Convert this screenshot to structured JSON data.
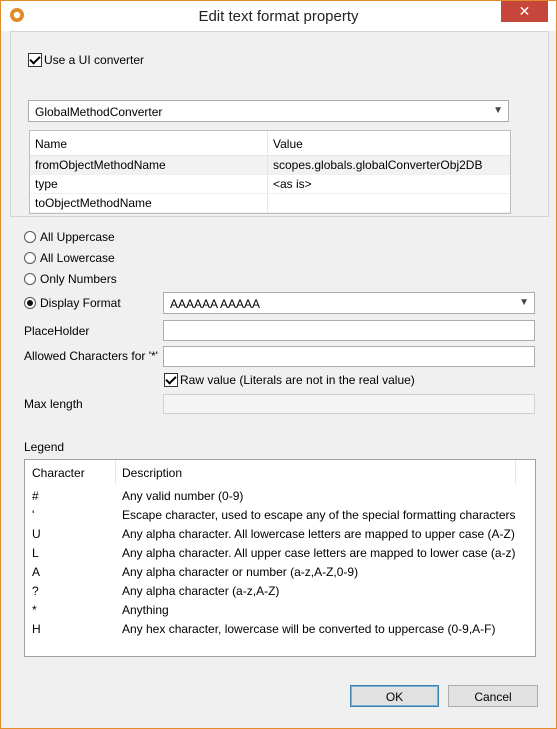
{
  "window": {
    "title": "Edit text format property"
  },
  "converter": {
    "use_ui_converter_label": "Use a UI converter",
    "use_ui_converter_checked": true,
    "selected": "GlobalMethodConverter",
    "columns": [
      "Name",
      "Value"
    ],
    "rows": [
      {
        "name": "fromObjectMethodName",
        "value": "scopes.globals.globalConverterObj2DB"
      },
      {
        "name": "type",
        "value": "<as is>"
      },
      {
        "name": "toObjectMethodName",
        "value": ""
      }
    ]
  },
  "format_options": {
    "all_uppercase": "All Uppercase",
    "all_lowercase": "All Lowercase",
    "only_numbers": "Only Numbers",
    "display_format": "Display Format",
    "selected": "display_format",
    "display_format_value": "AAAAAA AAAAA"
  },
  "fields": {
    "placeholder_label": "PlaceHolder",
    "placeholder_value": "",
    "allowed_chars_label": "Allowed Characters for '*'",
    "allowed_chars_value": "",
    "raw_value_label": "Raw value (Literals are not in the real value)",
    "raw_value_checked": true,
    "max_length_label": "Max length",
    "max_length_value": ""
  },
  "legend": {
    "title": "Legend",
    "columns": [
      "Character",
      "Description"
    ],
    "rows": [
      {
        "char": "#",
        "desc": "Any valid number (0-9)"
      },
      {
        "char": "'",
        "desc": "Escape character, used to escape any of the special formatting characters"
      },
      {
        "char": "U",
        "desc": "Any alpha character. All lowercase letters are mapped to upper case (A-Z)"
      },
      {
        "char": "L",
        "desc": "Any alpha character. All upper case letters are mapped to lower case (a-z)"
      },
      {
        "char": "A",
        "desc": "Any alpha character or number (a-z,A-Z,0-9)"
      },
      {
        "char": "?",
        "desc": "Any alpha character (a-z,A-Z)"
      },
      {
        "char": "*",
        "desc": "Anything"
      },
      {
        "char": "H",
        "desc": "Any hex character, lowercase will be converted to uppercase (0-9,A-F)"
      }
    ]
  },
  "buttons": {
    "ok": "OK",
    "cancel": "Cancel"
  },
  "colors": {
    "accent": "#e08c2a",
    "close": "#c7463c",
    "default_button_border": "#3c7fb1"
  },
  "icons": {
    "app": "app-logo-icon",
    "close": "close-icon",
    "dropdown": "chevron-down-icon"
  }
}
